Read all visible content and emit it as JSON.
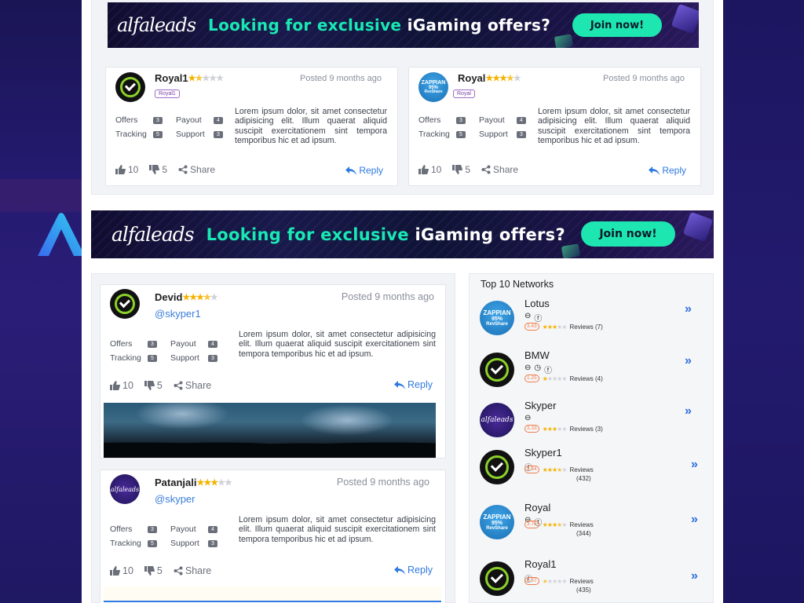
{
  "banner": {
    "logo": "alfaleads",
    "headline_highlight": "Looking for exclusive",
    "headline_white": "iGaming offers?",
    "cta": "Join now!"
  },
  "top_posts": [
    {
      "name": "Royal1",
      "rating": 1.5,
      "tag": "Royal1",
      "posted": "Posted 9 months ago",
      "metrics": {
        "offers_label": "Offers",
        "offers": "3",
        "payout_label": "Payout",
        "payout": "4",
        "tracking_label": "Tracking",
        "tracking": "5",
        "support_label": "Support",
        "support": "3"
      },
      "text": "Lorem ipsum dolor, sit amet consectetur adipisicing elit. Illum quaerat aliquid suscipit exercitationem sint tempora temporibus hic et ad ipsum.",
      "likes": "10",
      "dislikes": "5",
      "share": "Share",
      "reply": "Reply"
    },
    {
      "name": "Royal",
      "rating": 3.5,
      "tag": "Royal",
      "posted": "Posted 9 months ago",
      "metrics": {
        "offers_label": "Offers",
        "offers": "3",
        "payout_label": "Payout",
        "payout": "4",
        "tracking_label": "Tracking",
        "tracking": "5",
        "support_label": "Support",
        "support": "3"
      },
      "text": "Lorem ipsum dolor, sit amet consectetur adipisicing elit. Illum quaerat aliquid suscipit exercitationem sint tempora temporibus hic et ad ipsum.",
      "likes": "10",
      "dislikes": "5",
      "share": "Share",
      "reply": "Reply"
    }
  ],
  "feed_posts": [
    {
      "name": "Devid",
      "rating": 3.5,
      "handle": "@skyper1",
      "posted": "Posted 9 months ago",
      "metrics": {
        "offers_label": "Offers",
        "offers": "3",
        "payout_label": "Payout",
        "payout": "4",
        "tracking_label": "Tracking",
        "tracking": "5",
        "support_label": "Support",
        "support": "3"
      },
      "text": "Lorem ipsum dolor, sit amet consectetur adipisicing elit. Illum quaerat aliquid suscipit exercitationem sint tempora temporibus hic et ad ipsum.",
      "likes": "10",
      "dislikes": "5",
      "share": "Share",
      "reply": "Reply"
    },
    {
      "name": "Patanjali",
      "rating": 3,
      "handle": "@skyper",
      "posted": "Posted 9 months ago",
      "metrics": {
        "offers_label": "Offers",
        "offers": "3",
        "payout_label": "Payout",
        "payout": "4",
        "tracking_label": "Tracking",
        "tracking": "5",
        "support_label": "Support",
        "support": "3"
      },
      "text": "Lorem ipsum dolor, sit amet consectetur adipisicing elit. Illum quaerat aliquid suscipit exercitationem sint tempora temporibus hic et ad ipsum.",
      "likes": "10",
      "dislikes": "5",
      "share": "Share",
      "reply": "Reply"
    }
  ],
  "sidebar": {
    "title": "Top 10 Networks",
    "networks": [
      {
        "name": "Lotus",
        "score": "3.43",
        "rating": 3,
        "reviews": "Reviews (7)",
        "avatar": "zappian"
      },
      {
        "name": "BMW",
        "score": "1.25",
        "rating": 1,
        "reviews": "Reviews (4)",
        "avatar": "ok"
      },
      {
        "name": "Skyper",
        "score": "3.33",
        "rating": 3,
        "reviews": "Reviews (3)",
        "avatar": "alfa"
      },
      {
        "name": "Skyper1",
        "score": "3.64",
        "rating": 3.5,
        "reviews": "Reviews",
        "reviews_count": "(432)",
        "avatar": "ok"
      },
      {
        "name": "Royal",
        "score": "3.76",
        "rating": 3.5,
        "reviews": "Reviews",
        "reviews_count": "(344)",
        "avatar": "zappian"
      },
      {
        "name": "Royal1",
        "score": "0.57",
        "rating": 0.5,
        "reviews": "Reviews",
        "reviews_count": "(435)",
        "avatar": "ok"
      }
    ]
  },
  "avatar_text": {
    "zappian_top": "ZAPPIAN",
    "zappian_mid": "95%",
    "zappian_bot": "RevShare",
    "alfa": "alfaleads"
  },
  "colors": {
    "accent": "#2f7ae0",
    "star": "#f5b301",
    "banner_green": "#1ee6b0"
  }
}
